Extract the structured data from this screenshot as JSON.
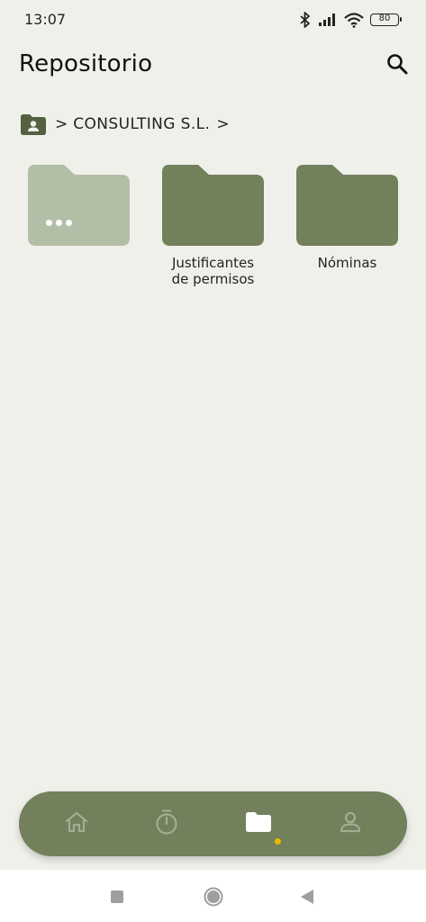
{
  "status_bar": {
    "time": "13:07",
    "battery_level": "80",
    "icons": [
      "bluetooth-icon",
      "signal-icon",
      "wifi-icon",
      "battery-icon"
    ]
  },
  "header": {
    "title": "Repositorio",
    "search_icon": "search-icon"
  },
  "breadcrumb": {
    "root_icon": "folder-person-icon",
    "separator": ">",
    "items": [
      "CONSULTING S.L."
    ]
  },
  "folders": [
    {
      "label": "",
      "kind": "more",
      "icon": "more-dots-icon"
    },
    {
      "label": "Justificantes de permisos",
      "kind": "folder"
    },
    {
      "label": "Nóminas",
      "kind": "folder"
    }
  ],
  "bottom_nav": {
    "items": [
      {
        "icon": "home-icon",
        "active": false
      },
      {
        "icon": "stopwatch-icon",
        "active": false
      },
      {
        "icon": "folder-icon",
        "active": true
      },
      {
        "icon": "profile-icon",
        "active": false
      }
    ]
  },
  "system_nav": [
    "recents-square-icon",
    "home-circle-icon",
    "back-triangle-icon"
  ],
  "colors": {
    "background": "#f0f0eb",
    "folder": "#72805c",
    "folder_faded": "#b3bea6",
    "nav_bar": "#72805c",
    "active_indicator": "#e7b900",
    "nav_icon_inactive": "#a3ad93",
    "nav_icon_active": "#ffffff"
  }
}
